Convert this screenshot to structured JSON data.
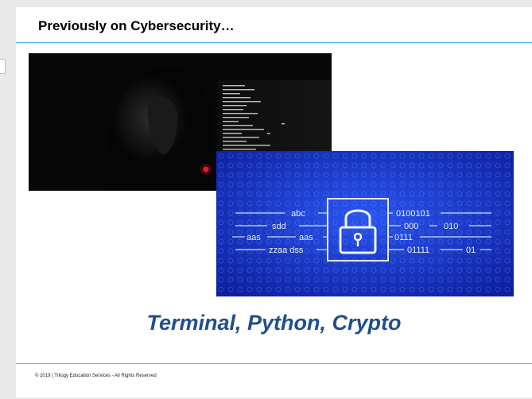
{
  "slide": {
    "title": "Previously on Cybersecurity…",
    "headline": "Terminal, Python, Crypto",
    "footer": "© 2019 | Trilogy Education Services - All Rights Reserved"
  },
  "images": {
    "hacker_photo": {
      "icon": "hooded-hacker-terminal-photo"
    },
    "crypto_graphic": {
      "icon": "padlock-binary-graphic",
      "left_labels": [
        "abc",
        "sdd",
        "aas",
        "aas",
        "zzaa dss"
      ],
      "right_labels": [
        "0100101",
        "000",
        "010",
        "0111",
        "01111",
        "01"
      ]
    }
  },
  "colors": {
    "accent_rule": "#4fc3e8",
    "headline": "#1f4e8c",
    "crypto_bg": "#1a3bd6"
  }
}
